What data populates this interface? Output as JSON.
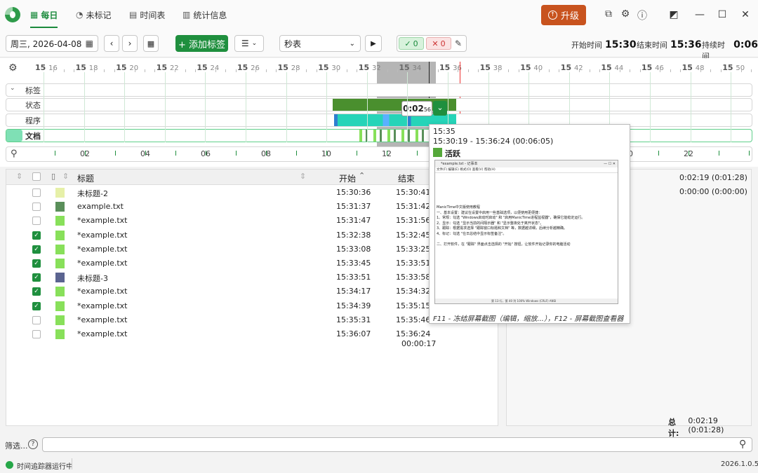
{
  "nav": {
    "tabs": [
      {
        "label": "每日",
        "icon": "calendar-icon"
      },
      {
        "label": "未标记",
        "icon": "untagged-icon"
      },
      {
        "label": "时间表",
        "icon": "timesheet-icon"
      },
      {
        "label": "统计信息",
        "icon": "stats-icon"
      }
    ],
    "upgrade_label": "升级"
  },
  "toolbar": {
    "date": "周三, 2026-04-08",
    "add_tag_label": "+ 添加标签",
    "stopwatch": "秒表",
    "count_ok": "0",
    "count_x": "0",
    "start_label": "开始时间",
    "start_value": "15:30",
    "end_label": "结束时间",
    "end_value": "15:36",
    "duration_label": "持续时间",
    "duration_value": "0:06"
  },
  "timeline": {
    "ticks": [
      {
        "h": "15",
        "m": "16"
      },
      {
        "h": "15",
        "m": "18"
      },
      {
        "h": "15",
        "m": "20"
      },
      {
        "h": "15",
        "m": "22"
      },
      {
        "h": "15",
        "m": "24"
      },
      {
        "h": "15",
        "m": "26"
      },
      {
        "h": "15",
        "m": "28"
      },
      {
        "h": "15",
        "m": "30"
      },
      {
        "h": "15",
        "m": "32"
      },
      {
        "h": "15",
        "m": "34"
      },
      {
        "h": "15",
        "m": "36"
      },
      {
        "h": "15",
        "m": "38"
      },
      {
        "h": "15",
        "m": "40"
      },
      {
        "h": "15",
        "m": "42"
      },
      {
        "h": "15",
        "m": "44"
      },
      {
        "h": "15",
        "m": "46"
      },
      {
        "h": "15",
        "m": "48"
      },
      {
        "h": "15",
        "m": "50"
      }
    ],
    "lanes": [
      "标签",
      "状态",
      "程序",
      "文档"
    ],
    "selection_duration": "0:02",
    "selection_seconds": "56",
    "hour_ticks": [
      "02",
      "04",
      "06",
      "08",
      "10",
      "12",
      "20",
      "22"
    ]
  },
  "table": {
    "headers": {
      "title": "标题",
      "start": "开始",
      "end": "结束"
    },
    "rows": [
      {
        "checked": false,
        "color": "#e6f0a8",
        "title": "未标题-2",
        "start": "15:30:36",
        "end": "15:30:41"
      },
      {
        "checked": false,
        "color": "#5a8f5a",
        "title": "example.txt",
        "start": "15:31:37",
        "end": "15:31:42"
      },
      {
        "checked": false,
        "color": "#88e05a",
        "title": "*example.txt",
        "start": "15:31:47",
        "end": "15:31:56"
      },
      {
        "checked": true,
        "color": "#88e05a",
        "title": "*example.txt",
        "start": "15:32:38",
        "end": "15:32:45"
      },
      {
        "checked": true,
        "color": "#88e05a",
        "title": "*example.txt",
        "start": "15:33:08",
        "end": "15:33:25"
      },
      {
        "checked": true,
        "color": "#88e05a",
        "title": "*example.txt",
        "start": "15:33:45",
        "end": "15:33:51"
      },
      {
        "checked": true,
        "color": "#5b6490",
        "title": "未标题-3",
        "start": "15:33:51",
        "end": "15:33:58"
      },
      {
        "checked": true,
        "color": "#88e05a",
        "title": "*example.txt",
        "start": "15:34:17",
        "end": "15:34:32"
      },
      {
        "checked": true,
        "color": "#88e05a",
        "title": "*example.txt",
        "start": "15:34:39",
        "end": "15:35:15"
      },
      {
        "checked": false,
        "color": "#88e05a",
        "title": "*example.txt",
        "start": "15:35:31",
        "end": "15:35:46"
      },
      {
        "checked": false,
        "color": "#88e05a",
        "title": "*example.txt",
        "start": "15:36:07",
        "end": "15:36:24",
        "duration": "00:00:17"
      }
    ]
  },
  "right": {
    "rows": [
      {
        "color": "#8b5a52",
        "value": "0:02:19 (0:01:28)"
      },
      {
        "color": "#ffffff",
        "value": "0:00:00 (0:00:00)"
      }
    ],
    "total_label": "总计:",
    "total_value": "0:02:19 (0:01:28)"
  },
  "popup": {
    "time": "15:35",
    "range": "15:30:19 - 15:36:24 (00:06:05)",
    "status": "活跃",
    "status_color": "#55a83a",
    "notepad_title": "*example.txt - 记事本",
    "notepad_menu": "文件(F)  编辑(E)  格式(O)  查看(V)  帮助(H)",
    "notepad_lines": [
      "ManicTime中文版使用教程",
      "一、基本设置：建议在设置中启用一些基础选项，以便使用更便捷：",
      "1、常规：勾选 \"Windows启动时启动\" 和 \"启用ManicTime进程监视器\"，确保它能稳定运行。",
      "2、显示：勾选 \"显示当前的间隔示器\" 和 \"显示整夜处于离开状态\"。",
      "3、跟踪：根据需求选择 \"跟踪窗口标题和文档\" 等，数据越详细，后续分析越精确。",
      "4、标记：勾选 \"在日总结中显示标签备注\"。",
      "",
      "二、打开软件，在 \"跟踪\" 界面点击选择的 \"开始\" 按钮，让软件开始记录你的电脑活动"
    ],
    "notepad_status": "第 13 行，第 40 列    100%    Windows (CRLF)    ANSI",
    "footer": "F11 - 冻结屏幕截图（编辑，缩放...），F12 - 屏幕截图查看器"
  },
  "bottom": {
    "filter_label": "筛选...",
    "status_text": "时间追踪器运行中",
    "version": "2026.1.0.5"
  }
}
